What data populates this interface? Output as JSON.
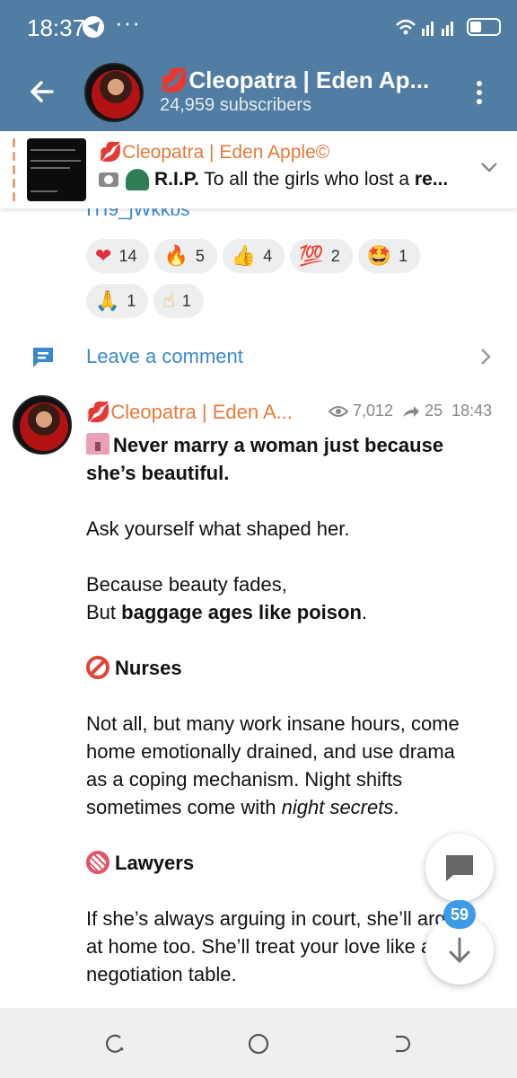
{
  "status_bar": {
    "time": "18:37",
    "more": "···"
  },
  "header": {
    "channel_name": "💋Cleopatra | Eden Ap...",
    "subscribers": "24,959 subscribers"
  },
  "pinned": {
    "title": "💋Cleopatra | Eden Apple©",
    "text_bold": "R.I.P.",
    "text_rest": " To all the girls who lost a ",
    "text_bold_end": "re..."
  },
  "message1": {
    "link_fragment": "ITI9_jWkkbs",
    "reactions": [
      {
        "emoji": "❤",
        "count": "14"
      },
      {
        "emoji": "🔥",
        "count": "5"
      },
      {
        "emoji": "👍",
        "count": "4"
      },
      {
        "emoji": "💯",
        "count": "2"
      },
      {
        "emoji": "🤩",
        "count": "1"
      },
      {
        "emoji": "🙏",
        "count": "1"
      },
      {
        "emoji": "☝",
        "count": "1"
      }
    ],
    "leave_comment": "Leave a comment"
  },
  "message2": {
    "sender": "💋Cleopatra | Eden A...",
    "views": "7,012",
    "forwards": "25",
    "time": "18:43",
    "title_line": "Never marry a woman just because she’s beautiful.",
    "p1": "Ask yourself what shaped her.",
    "p2_a": "Because beauty fades,",
    "p2_b_plain": "But ",
    "p2_b_bold": "baggage ages like poison",
    "p2_b_end": ".",
    "h_nurses": "Nurses",
    "p3_a": "Not all, but many work insane hours, come home emotionally drained, and use drama as a coping mechanism. Night shifts sometimes come with ",
    "p3_italic": "night secrets",
    "p3_end": ".",
    "h_lawyers": "Lawyers",
    "p4": "If she’s always arguing in court, she’ll argue at home too. She’ll treat your love like a negotiation table."
  },
  "floating": {
    "unread_count": "59"
  },
  "colors": {
    "header_bg": "#517da2",
    "accent_link": "#3a89cf",
    "name_orange": "#e8793a",
    "badge": "#3c9be8"
  }
}
